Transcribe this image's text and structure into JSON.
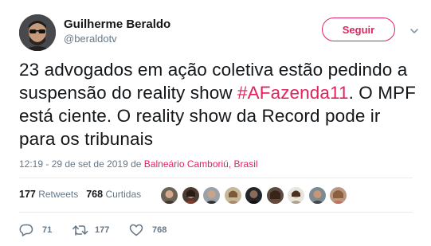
{
  "user": {
    "name": "Guilherme Beraldo",
    "handle": "@beraldotv"
  },
  "follow_button": {
    "label": "Seguir"
  },
  "tweet": {
    "text_before": "23 advogados em ação coletiva estão pedindo a suspensão do reality show ",
    "hashtag": "#AFazenda11",
    "text_after": ". O MPF está ciente. O reality show da Record pode ir para os tribunais"
  },
  "meta": {
    "time_date": "12:19 - 29 de set de 2019 de ",
    "location": "Balneário Camboriú, Brasil"
  },
  "stats": {
    "retweets_count": "177",
    "retweets_label": "Retweets",
    "likes_count": "768",
    "likes_label": "Curtidas"
  },
  "actions": {
    "replies": "71",
    "retweets": "177",
    "likes": "768"
  },
  "colors": {
    "accent": "#e0245e",
    "secondary_text": "#657786",
    "primary_text": "#14171a",
    "divider": "#e6ecf0"
  },
  "icons": {
    "reply": "reply-icon",
    "retweet": "retweet-icon",
    "like": "heart-icon",
    "caret": "chevron-down-icon"
  }
}
